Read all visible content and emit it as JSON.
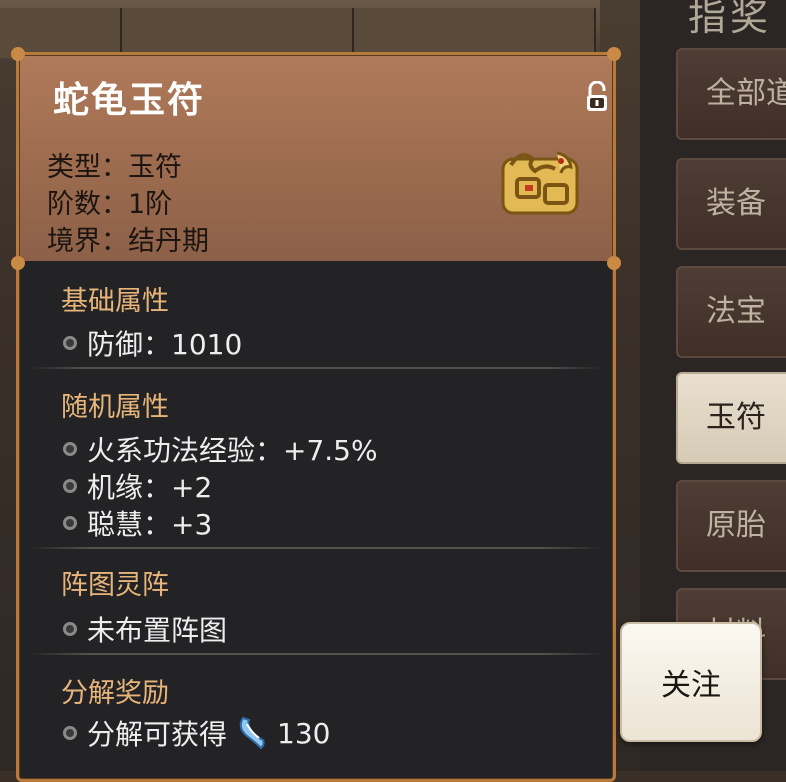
{
  "item": {
    "name": "蛇龟玉符",
    "type_label": "类型：",
    "type_value": "玉符",
    "tier_label": "阶数：",
    "tier_value": "1阶",
    "realm_label": "境界：",
    "realm_value": "结丹期",
    "icon": "snake-turtle-talisman-icon",
    "lock_icon": "unlocked-padlock-icon"
  },
  "sections": {
    "base": {
      "title": "基础属性",
      "attrs": [
        {
          "text": "防御：1010"
        }
      ]
    },
    "random": {
      "title": "随机属性",
      "attrs": [
        {
          "text": "火系功法经验：+7.5%"
        },
        {
          "text": "机缘：+2"
        },
        {
          "text": "聪慧：+3"
        }
      ]
    },
    "formation": {
      "title": "阵图灵阵",
      "attrs": [
        {
          "text": "未布置阵图"
        }
      ]
    },
    "decompose": {
      "title": "分解奖励",
      "label": "分解可获得",
      "currency_icon": "jade-slip-icon",
      "amount": "130"
    }
  },
  "follow_button": {
    "label": "关注"
  },
  "side_panel": {
    "title": "指奖",
    "tabs": [
      "全部道",
      "装备",
      "法宝",
      "玉符",
      "原胎",
      "材料"
    ],
    "active_tab_index": 3
  },
  "colors": {
    "header_bg": "#a87458",
    "body_bg": "#232325",
    "section_title": "#e7b57a",
    "frame": "#b77a3c"
  }
}
